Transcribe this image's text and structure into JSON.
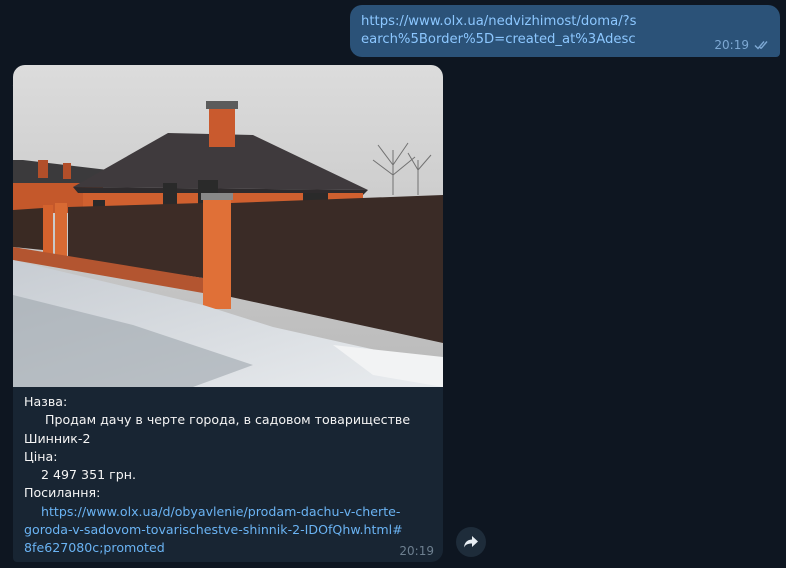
{
  "outgoing": {
    "link_text": "https://www.olx.ua/nedvizhimost/doma/?search%5Border%5D=created_at%3Adesc",
    "time": "20:19",
    "status_icon": "double-check-icon"
  },
  "incoming": {
    "photo": {
      "description_icon": "house-photo"
    },
    "caption": {
      "name_label": "Назва:",
      "name_value": "Продам дачу в черте города, в садовом товариществе Шинник-2",
      "price_label": "Ціна:",
      "price_value": "2 497 351 грн.",
      "link_label": "Посилання:",
      "link_value": "https://www.olx.ua/d/obyavlenie/prodam-dachu-v-cherte-goroda-v-sadovom-tovarischestve-shinnik-2-IDOfQhw.html#8fe627080c;promoted"
    },
    "time": "20:19"
  },
  "share_button": {
    "icon": "share-arrow-icon"
  },
  "colors": {
    "background": "#0e1621",
    "outgoing_bubble": "#2b5278",
    "incoming_bubble": "#182533",
    "link": "#6ab3f3"
  }
}
